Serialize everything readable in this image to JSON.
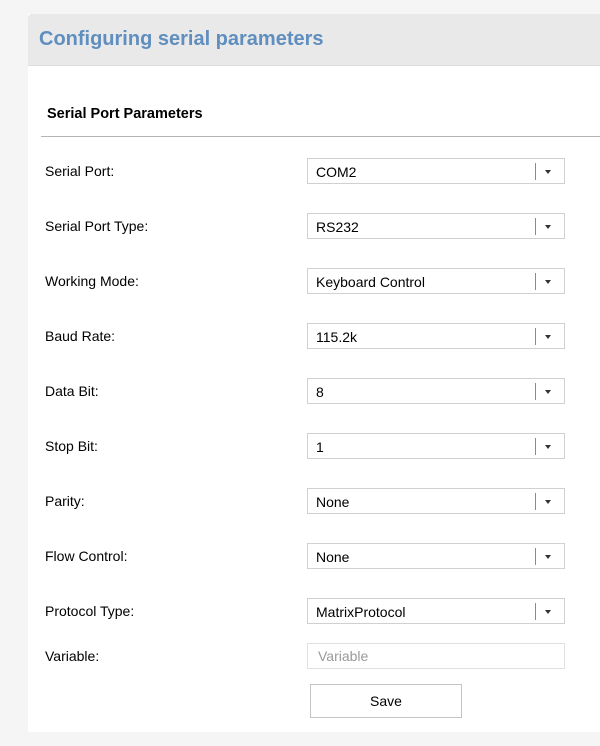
{
  "header": {
    "title": "Configuring serial parameters"
  },
  "section": {
    "title": "Serial Port Parameters"
  },
  "fields": [
    {
      "label": "Serial Port:",
      "value": "COM2"
    },
    {
      "label": "Serial Port Type:",
      "value": "RS232"
    },
    {
      "label": "Working Mode:",
      "value": "Keyboard Control"
    },
    {
      "label": "Baud Rate:",
      "value": "115.2k"
    },
    {
      "label": "Data Bit:",
      "value": "8"
    },
    {
      "label": "Stop Bit:",
      "value": "1"
    },
    {
      "label": "Parity:",
      "value": "None"
    },
    {
      "label": "Flow Control:",
      "value": "None"
    },
    {
      "label": "Protocol Type:",
      "value": "MatrixProtocol"
    }
  ],
  "variable": {
    "label": "Variable:",
    "value": "",
    "placeholder": "Variable"
  },
  "actions": {
    "save_label": "Save"
  },
  "icons": {
    "dropdown": "chevron-down-icon"
  },
  "colors": {
    "title": "#5f8ebf",
    "header_bg": "#e9e9e9",
    "page_bg": "#f5f5f5"
  }
}
